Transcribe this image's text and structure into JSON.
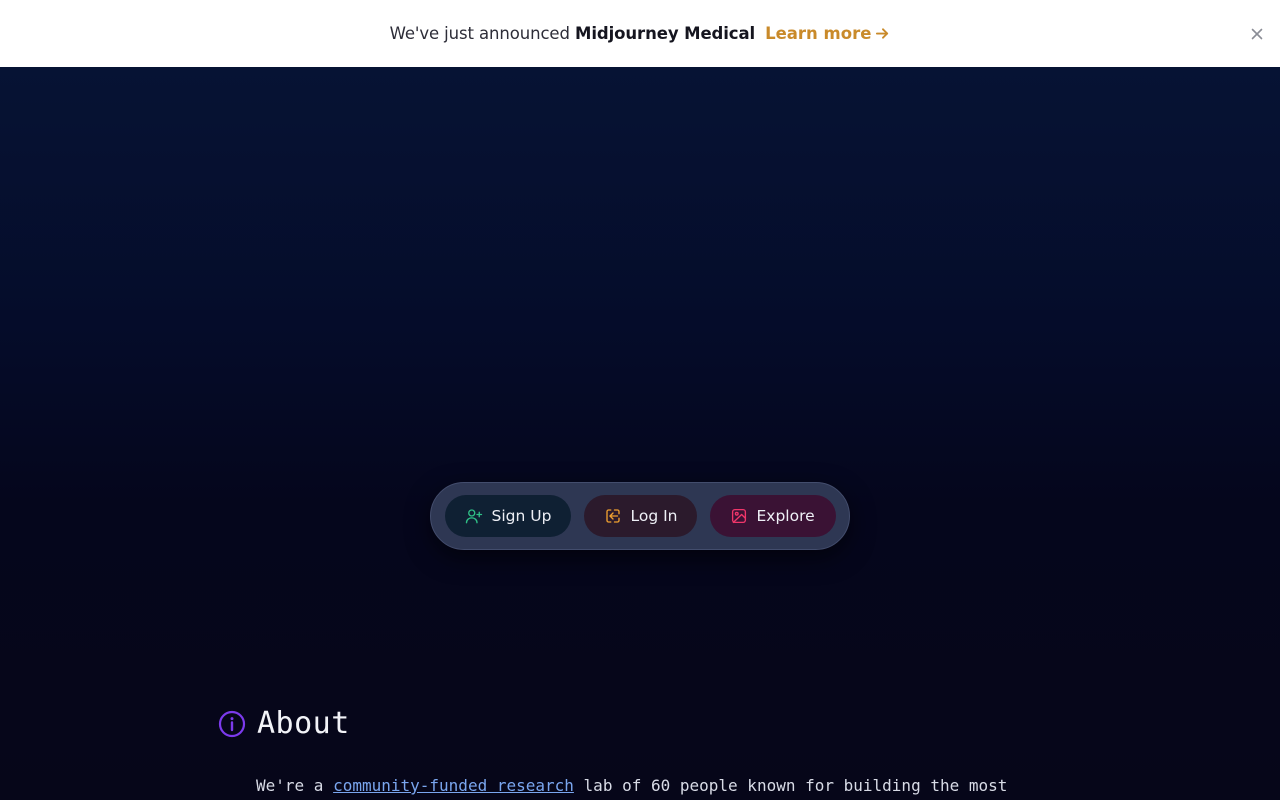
{
  "announcement": {
    "prefix": "We've just announced",
    "product": "Midjourney Medical",
    "link_label": "Learn more",
    "link_icon": "arrow-right-icon",
    "close_icon": "close-icon",
    "link_color": "#c98a2a"
  },
  "actions": {
    "signup": {
      "label": "Sign Up",
      "icon": "user-plus-icon",
      "color": "#2fbf86"
    },
    "login": {
      "label": "Log In",
      "icon": "login-icon",
      "color": "#f0a030"
    },
    "explore": {
      "label": "Explore",
      "icon": "image-icon",
      "color": "#f0366a"
    }
  },
  "about": {
    "icon": "info-icon",
    "icon_color": "#7c3aed",
    "title": "About",
    "text_prefix": "We're a",
    "link_text": "community-funded research",
    "text_suffix": "lab of 60 people known for building the most"
  }
}
